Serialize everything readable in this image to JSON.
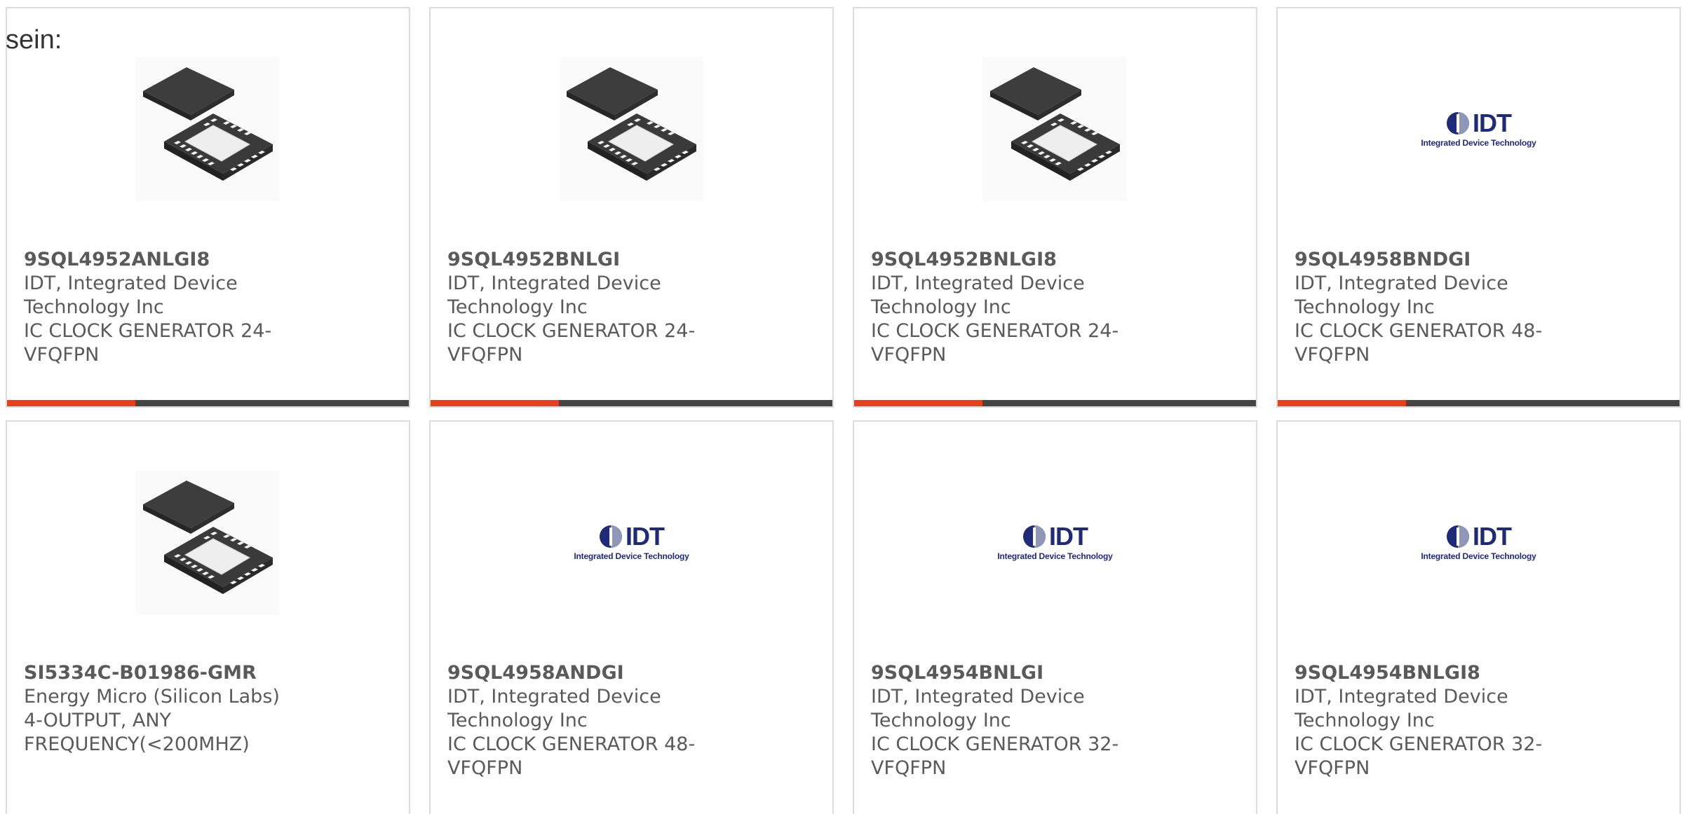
{
  "intro_text": "sein:",
  "accent_color": "#e8401b",
  "bar_color": "#454545",
  "logo": {
    "brand": "IDT",
    "tagline": "Integrated Device Technology"
  },
  "products": [
    {
      "part_number": "9SQL4952ANLGI8",
      "manufacturer": "IDT, Integrated Device Technology Inc",
      "description": "IC CLOCK GENERATOR 24-VFQFPN",
      "image": "chip-package-icon",
      "progress": 0.32
    },
    {
      "part_number": "9SQL4952BNLGI",
      "manufacturer": "IDT, Integrated Device Technology Inc",
      "description": "IC CLOCK GENERATOR 24-VFQFPN",
      "image": "chip-package-icon",
      "progress": 0.32
    },
    {
      "part_number": "9SQL4952BNLGI8",
      "manufacturer": "IDT, Integrated Device Technology Inc",
      "description": "IC CLOCK GENERATOR 24-VFQFPN",
      "image": "chip-package-icon",
      "progress": 0.32
    },
    {
      "part_number": "9SQL4958BNDGI",
      "manufacturer": "IDT, Integrated Device Technology Inc",
      "description": "IC CLOCK GENERATOR 48-VFQFPN",
      "image": "idt-logo",
      "progress": 0.32
    },
    {
      "part_number": "SI5334C-B01986-GMR",
      "manufacturer": "Energy Micro (Silicon Labs)",
      "description": "4-OUTPUT, ANY FREQUENCY(<200MHZ)",
      "image": "chip-package-icon"
    },
    {
      "part_number": "9SQL4958ANDGI",
      "manufacturer": "IDT, Integrated Device Technology Inc",
      "description": "IC CLOCK GENERATOR 48-VFQFPN",
      "image": "idt-logo"
    },
    {
      "part_number": "9SQL4954BNLGI",
      "manufacturer": "IDT, Integrated Device Technology Inc",
      "description": "IC CLOCK GENERATOR 32-VFQFPN",
      "image": "idt-logo"
    },
    {
      "part_number": "9SQL4954BNLGI8",
      "manufacturer": "IDT, Integrated Device Technology Inc",
      "description": "IC CLOCK GENERATOR 32-VFQFPN",
      "image": "idt-logo"
    }
  ]
}
